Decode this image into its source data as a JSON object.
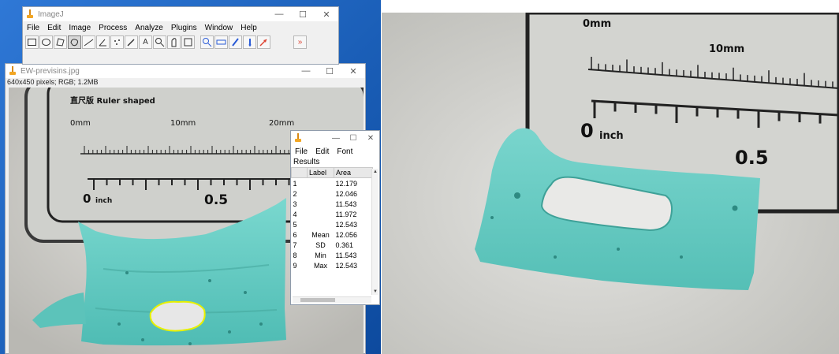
{
  "imagej": {
    "title": "ImageJ",
    "menu": [
      "File",
      "Edit",
      "Image",
      "Process",
      "Analyze",
      "Plugins",
      "Window",
      "Help"
    ],
    "tools": [
      "rectangle-tool",
      "oval-tool",
      "polygon-tool",
      "freehand-tool",
      "line-tool",
      "angle-tool",
      "point-tool",
      "wand-tool",
      "text-tool",
      "magnifier-tool",
      "scroll-tool",
      "dropper-tool",
      "color-tool",
      "zoom-tool",
      "lut-tool",
      "pencil-tool",
      "brush-tool",
      "arrow-tool",
      "more-tools"
    ],
    "window_controls": [
      "—",
      "☐",
      "✕"
    ]
  },
  "image_window": {
    "title": "EW-previsins.jpg",
    "info": "640x450 pixels; RGB; 1.2MB",
    "window_controls": [
      "—",
      "☐",
      "✕"
    ]
  },
  "ruler": {
    "caption": "直尺版  Ruler shaped",
    "mm_zero": "0mm",
    "mm_ten": "10mm",
    "mm_twenty": "20mm",
    "inch_zero": "0",
    "inch_word": "inch",
    "inch_half": "0.5"
  },
  "results": {
    "window_controls": [
      "—",
      "☐",
      "✕"
    ],
    "menu": [
      "File",
      "Edit",
      "Font"
    ],
    "subtitle": "Results",
    "columns": [
      "",
      "Label",
      "Area"
    ],
    "rows": [
      [
        "1",
        "",
        "12.179"
      ],
      [
        "2",
        "",
        "12.046"
      ],
      [
        "3",
        "",
        "11.543"
      ],
      [
        "4",
        "",
        "11.972"
      ],
      [
        "5",
        "",
        "12.543"
      ],
      [
        "6",
        "Mean",
        "12.056"
      ],
      [
        "7",
        "SD",
        "0.361"
      ],
      [
        "8",
        "Min",
        "11.543"
      ],
      [
        "9",
        "Max",
        "12.543"
      ]
    ]
  },
  "photo_right": {
    "mm_zero": "0mm",
    "mm_ten": "10mm",
    "inch_zero": "0",
    "inch_word": "inch",
    "inch_half": "0.5"
  },
  "colors": {
    "desktop": "#1b5fb8",
    "sample": "#6fd1c8",
    "background_paper": "#dcdcd8",
    "outline_selection": "#e6f000"
  }
}
